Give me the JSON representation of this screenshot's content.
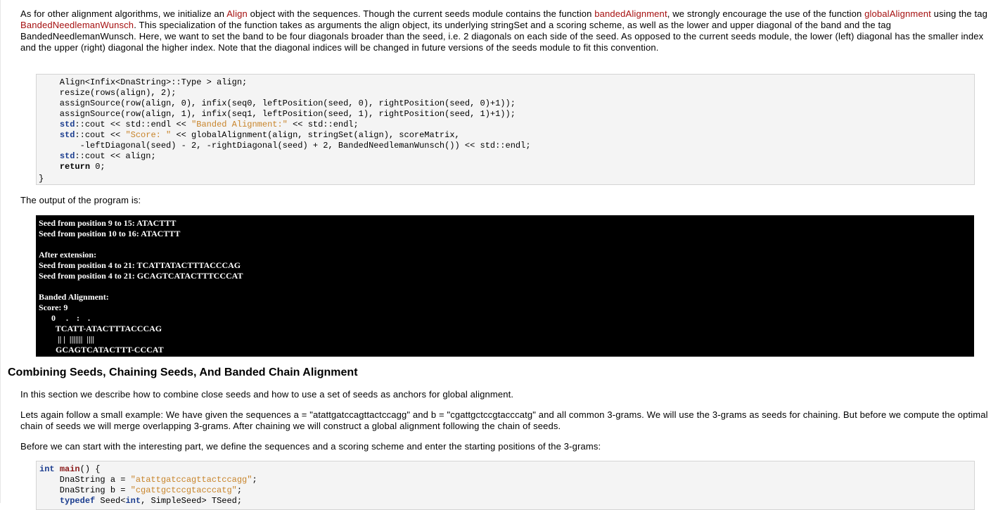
{
  "intro": {
    "t1": "As for other alignment algorithms, we initialize an ",
    "l1": "Align",
    "t2": " object with the sequences. Though the current seeds module contains the function ",
    "l2": "bandedAlignment",
    "t3": ", we strongly encourage the use of the function ",
    "l3": "globalAlignment",
    "t4": " using the tag ",
    "l4": "BandedNeedlemanWunsch",
    "t5": ". This specialization of the function takes as arguments the align object, its underlying stringSet and a scoring scheme, as well as the lower and upper diagonal of the band and the tag BandedNeedlemanWunsch. Here, we want to set the band to be four diagonals broader than the seed, i.e. 2 diagonals on each side of the seed. As opposed to the current seeds module, the lower (left) diagonal has the smaller index and the upper (right) diagonal the higher index. Note that the diagonal indices will be changed in future versions of the seeds module to fit this convention."
  },
  "code1": {
    "l1": "    Align<Infix<DnaString>::Type > align;",
    "l2": "    resize(rows(align), 2);",
    "l3": "    assignSource(row(align, 0), infix(seq0, leftPosition(seed, 0), rightPosition(seed, 0)+1));",
    "l4": "    assignSource(row(align, 1), infix(seq1, leftPosition(seed, 1), rightPosition(seed, 1)+1));",
    "l5_indent": "    ",
    "l5_std": "std",
    "l5_mid": "::cout << std::endl << ",
    "l5_str": "\"Banded Alignment:\"",
    "l5_end": " << std::endl;",
    "l6_indent": "    ",
    "l6_std": "std",
    "l6_mid": "::cout << ",
    "l6_str": "\"Score: \"",
    "l6_end": " << globalAlignment(align, stringSet(align), scoreMatrix,",
    "l7": "        -leftDiagonal(seed) - 2, -rightDiagonal(seed) + 2, BandedNeedlemanWunsch()) << std::endl;",
    "l8_indent": "    ",
    "l8_std": "std",
    "l8_end": "::cout << align;",
    "l9_indent": "    ",
    "l9_kw": "return",
    "l9_end": " 0;",
    "closing": "}"
  },
  "output_intro": "The output of the program is:",
  "output": [
    "Seed from position 9 to 15: ATACTTT",
    "Seed from position 10 to 16: ATACTTT",
    "",
    "After extension:",
    "Seed from position 4 to 21: TCATTATACTTTACCCAG",
    "Seed from position 4 to 21: GCAGTCATACTTTCCCAT",
    "",
    "Banded Alignment:",
    "Score: 9",
    "      0     .    :    .",
    "        TCATT-ATACTTTACCCAG",
    "         || |  |||||||  ||||",
    "        GCAGTCATACTTT-CCCAT"
  ],
  "section_heading": "Combining Seeds, Chaining Seeds, And Banded Chain Alignment",
  "para_section": "In this section we describe how to combine close seeds and how to use a set of seeds as anchors for global alignment.",
  "para_example": "Lets again follow a small example: We have given the sequences a = \"atattgatccagttactccagg\" and b = \"cgattgctccgtacccatg\" and all common 3-grams. We will use the 3-grams as seeds for chaining. But before we compute the optimal chain of seeds we will merge overlapping 3-grams. After chaining we will construct a global alignment following the chain of seeds.",
  "para_before": "Before we can start with the interesting part, we define the sequences and a scoring scheme and enter the starting positions of the 3-grams:",
  "code2": {
    "l1_kw": "int",
    "l1_sp": " ",
    "l1_fn": "main",
    "l1_end": "() {",
    "l2_start": "    DnaString a = ",
    "l2_str": "\"atattgatccagttactccagg\"",
    "l2_end": ";",
    "l3_start": "    DnaString b = ",
    "l3_str": "\"cgattgctccgtacccatg\"",
    "l3_end": ";",
    "l4_indent": "    ",
    "l4_kw": "typedef",
    "l4_mid": " Seed<",
    "l4_kw2": "int",
    "l4_end": ", SimpleSeed> TSeed;"
  }
}
